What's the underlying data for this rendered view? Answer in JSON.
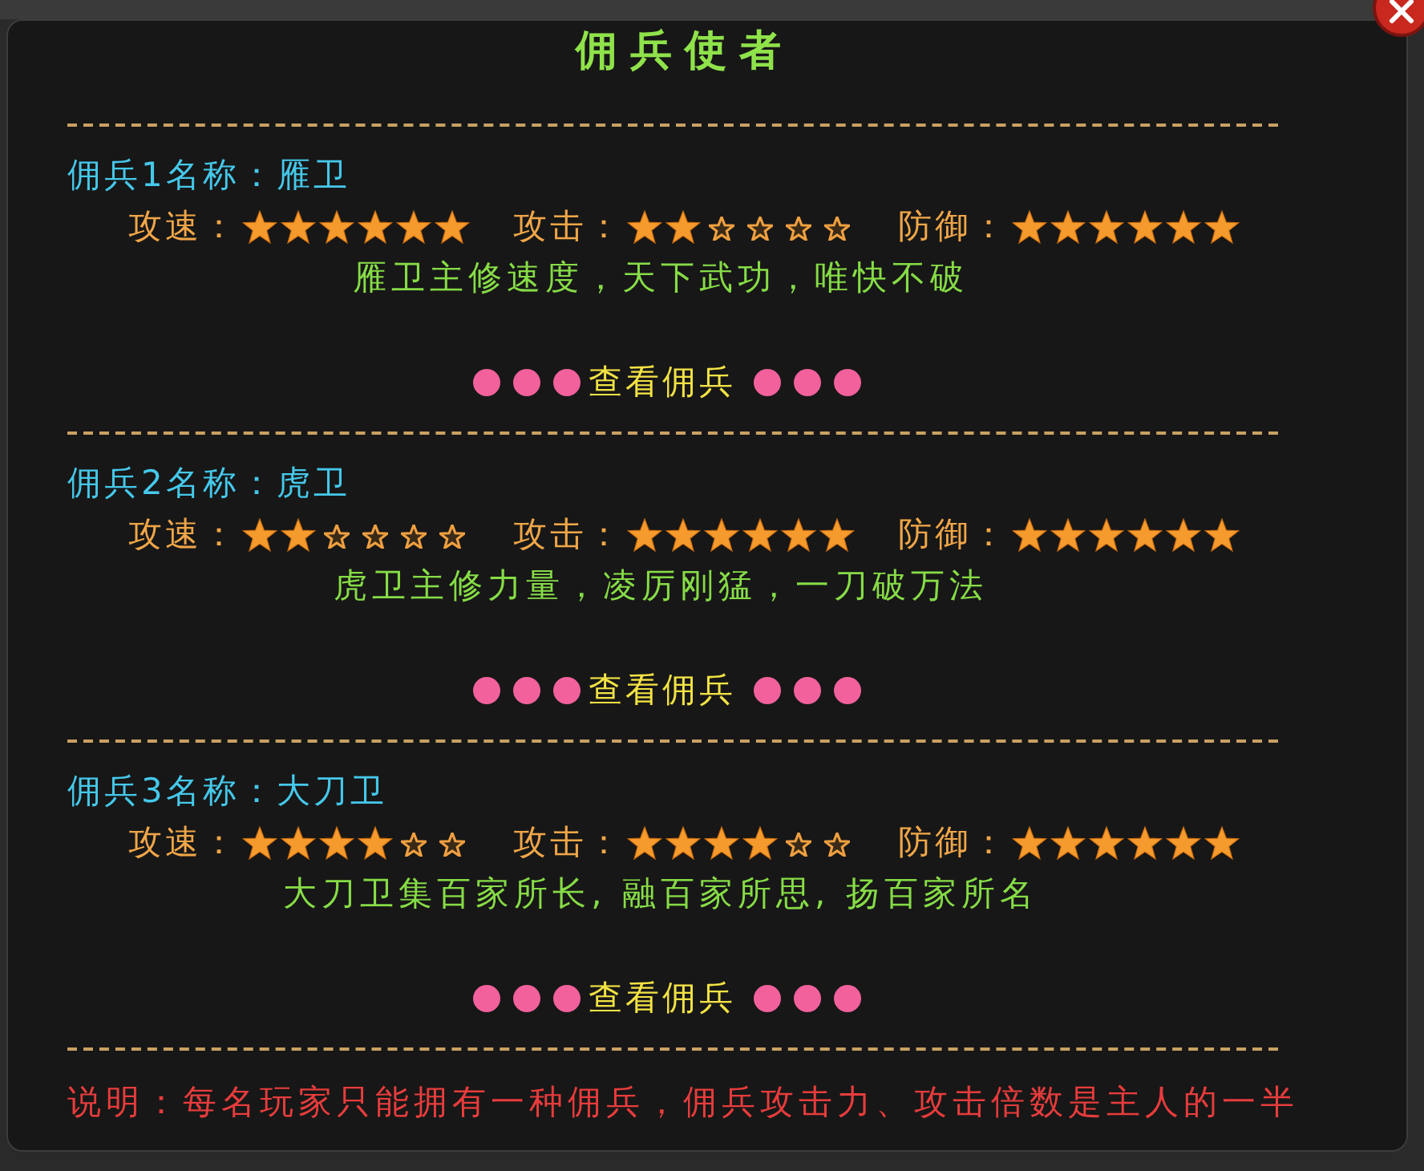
{
  "window": {
    "title": "佣兵使者"
  },
  "mercenaries": [
    {
      "name_line": "佣兵1名称：雁卫",
      "stats": [
        {
          "label": "攻速：",
          "stars": 6
        },
        {
          "label": "攻击：",
          "stars": 2
        },
        {
          "label": "防御：",
          "stars": 6
        }
      ],
      "description": "雁卫主修速度，天下武功，唯快不破",
      "view_link": "查看佣兵"
    },
    {
      "name_line": "佣兵2名称：虎卫",
      "stats": [
        {
          "label": "攻速：",
          "stars": 2
        },
        {
          "label": "攻击：",
          "stars": 6
        },
        {
          "label": "防御：",
          "stars": 6
        }
      ],
      "description": "虎卫主修力量，凌厉刚猛，一刀破万法",
      "view_link": "查看佣兵"
    },
    {
      "name_line": "佣兵3名称：大刀卫",
      "stats": [
        {
          "label": "攻速：",
          "stars": 4
        },
        {
          "label": "攻击：",
          "stars": 4
        },
        {
          "label": "防御：",
          "stars": 6
        }
      ],
      "description": "大刀卫集百家所长, 融百家所思, 扬百家所名",
      "view_link": "查看佣兵"
    }
  ],
  "note": "说明：每名玩家只能拥有一种佣兵，佣兵攻击力、攻击倍数是主人的一半"
}
